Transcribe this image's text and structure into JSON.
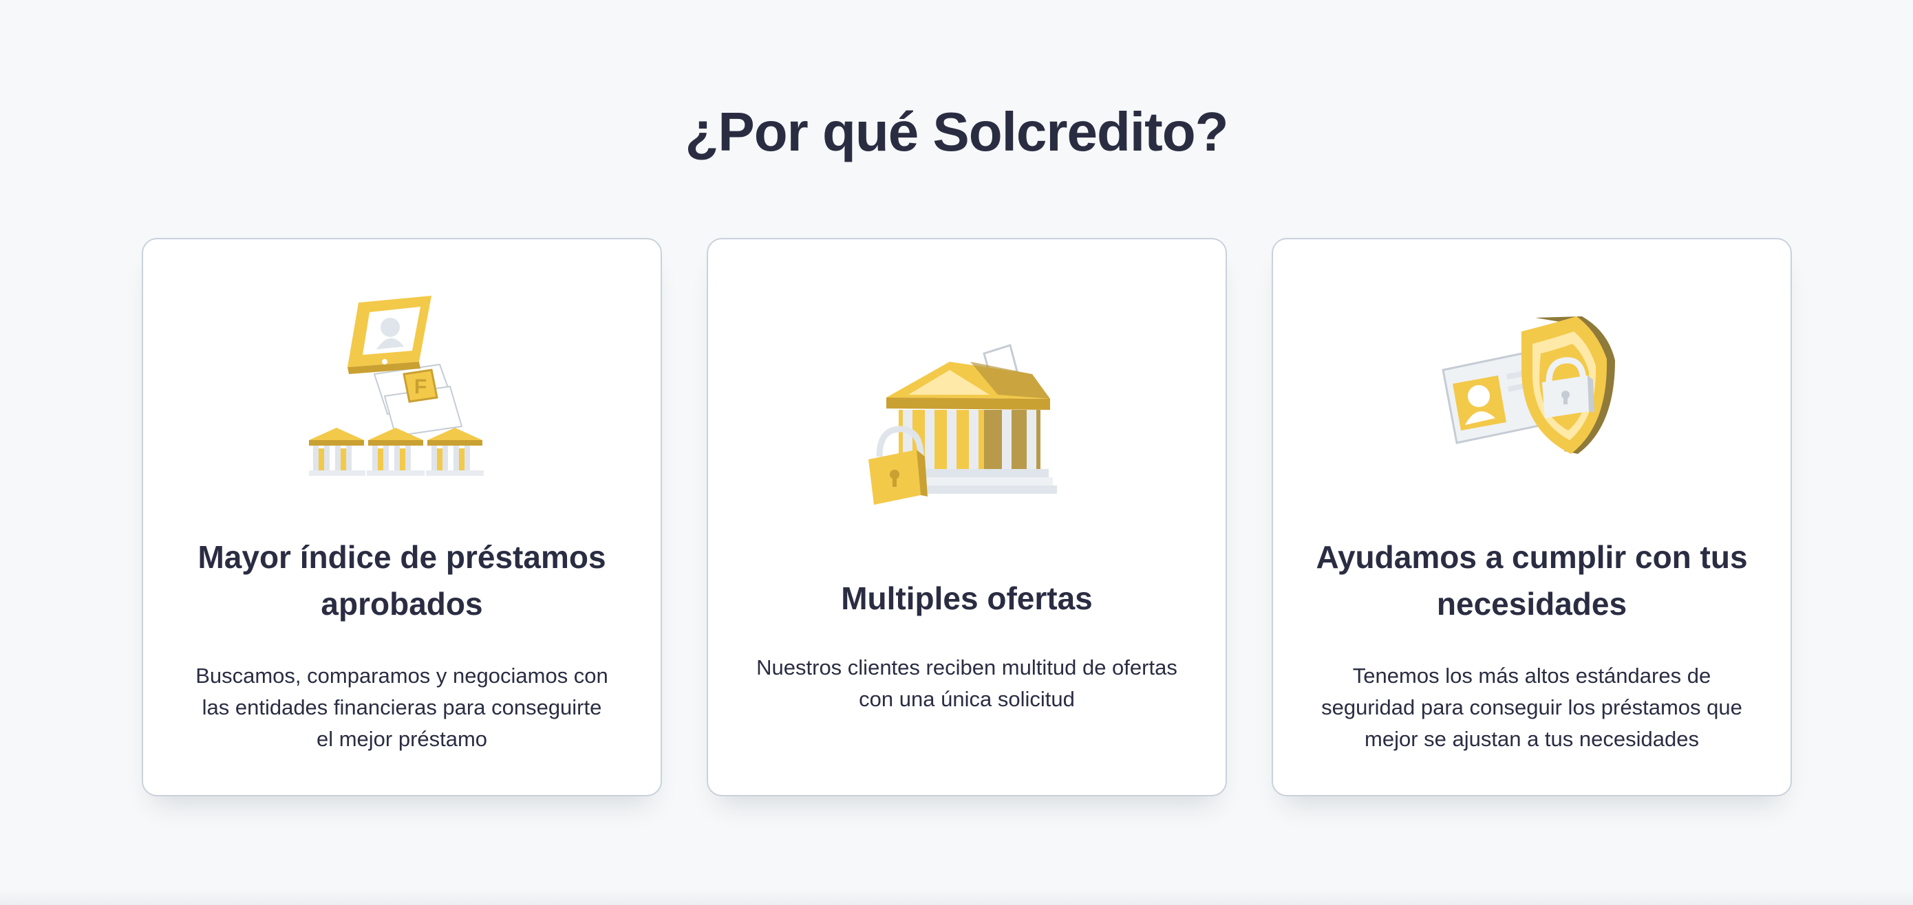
{
  "section": {
    "title": "¿Por qué Solcredito?"
  },
  "cards": [
    {
      "title": "Mayor índice de préstamos aprobados",
      "text": "Buscamos, comparamos y negociamos con las entidades financieras para conseguirte el mejor préstamo",
      "icon": "phone-banks-icon"
    },
    {
      "title": "Multiples ofertas",
      "text": "Nuestros clientes reciben multitud de ofertas con una única solicitud",
      "icon": "bank-lock-icon"
    },
    {
      "title": "Ayudamos a cumplir con tus necesidades",
      "text": "Tenemos los más altos estándares de seguridad para conseguir los préstamos que mejor se ajustan a tus necesidades",
      "icon": "id-card-shield-icon"
    }
  ],
  "colors": {
    "background": "#f6f8f9",
    "heading": "#2a2d42",
    "card_border": "#c9d2dc",
    "accent_gold": "#f3c94a",
    "accent_gold_dark": "#c9a032",
    "accent_grey": "#dfe5ea"
  }
}
